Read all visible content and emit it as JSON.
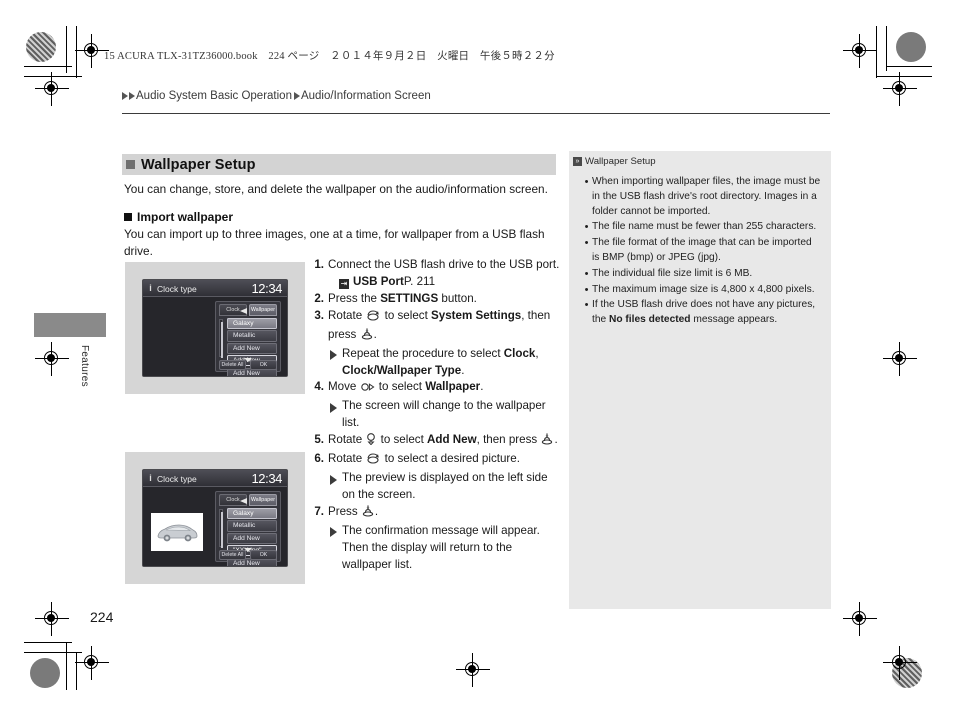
{
  "book_header": "15 ACURA TLX-31TZ36000.book　224 ページ　２０１４年９月２日　火曜日　午後５時２２分",
  "breadcrumb": {
    "crumb1": "Audio System Basic Operation",
    "crumb2": "Audio/Information Screen"
  },
  "side_tab": {
    "label": "Features"
  },
  "page_number": "224",
  "section": {
    "title": "Wallpaper Setup",
    "description": "You can change, store, and delete the wallpaper on the audio/information screen."
  },
  "subsection": {
    "title": "Import wallpaper",
    "description": "You can import up to three images, one at a time, for wallpaper from a USB flash drive."
  },
  "steps": [
    {
      "num": "1.",
      "text_parts": [
        {
          "t": "Connect the USB flash drive to the USB port."
        }
      ],
      "reference": {
        "icon": "arrow-into-box-icon",
        "label": "USB Port",
        "page": "P. 211"
      }
    },
    {
      "num": "2.",
      "text_parts": [
        {
          "t": "Press the "
        },
        {
          "t": "SETTINGS",
          "bold": true
        },
        {
          "t": " button."
        }
      ]
    },
    {
      "num": "3.",
      "text_parts": [
        {
          "t": "Rotate "
        },
        {
          "icon": "rotate-knob-icon"
        },
        {
          "t": " to select "
        },
        {
          "t": "System Settings",
          "bold": true
        },
        {
          "t": ", then press "
        },
        {
          "icon": "press-knob-icon"
        },
        {
          "t": "."
        }
      ],
      "subs": [
        {
          "parts": [
            {
              "t": "Repeat the procedure to select "
            },
            {
              "t": "Clock",
              "bold": true
            },
            {
              "t": ", "
            },
            {
              "t": "Clock/Wallpaper Type",
              "bold": true
            },
            {
              "t": "."
            }
          ]
        }
      ]
    },
    {
      "num": "4.",
      "text_parts": [
        {
          "t": "Move "
        },
        {
          "icon": "move-right-icon"
        },
        {
          "t": " to select "
        },
        {
          "t": "Wallpaper",
          "bold": true
        },
        {
          "t": "."
        }
      ],
      "subs": [
        {
          "parts": [
            {
              "t": "The screen will change to the wallpaper list."
            }
          ]
        }
      ]
    },
    {
      "num": "5.",
      "text_parts": [
        {
          "t": "Rotate "
        },
        {
          "icon": "rotate-down-icon"
        },
        {
          "t": " to select "
        },
        {
          "t": "Add New",
          "bold": true
        },
        {
          "t": ", then press "
        },
        {
          "icon": "press-knob-icon"
        },
        {
          "t": "."
        }
      ]
    },
    {
      "num": "6.",
      "text_parts": [
        {
          "t": "Rotate "
        },
        {
          "icon": "rotate-knob-icon"
        },
        {
          "t": " to select a desired picture."
        }
      ],
      "subs": [
        {
          "parts": [
            {
              "t": "The preview is displayed on the left side on the screen."
            }
          ]
        }
      ]
    },
    {
      "num": "7.",
      "text_parts": [
        {
          "t": "Press "
        },
        {
          "icon": "press-knob-icon"
        },
        {
          "t": "."
        }
      ],
      "subs": [
        {
          "parts": [
            {
              "t": "The confirmation message will appear. Then the display will return to the wallpaper list."
            }
          ]
        }
      ]
    }
  ],
  "note": {
    "heading": "Wallpaper Setup",
    "items": [
      {
        "parts": [
          {
            "t": "When importing wallpaper files, the image must be in the USB flash drive's root directory. Images in a folder cannot be imported."
          }
        ]
      },
      {
        "parts": [
          {
            "t": "The file name must be fewer than 255 characters."
          }
        ]
      },
      {
        "parts": [
          {
            "t": "The file format of the image that can be imported is BMP (bmp) or JPEG (jpg)."
          }
        ]
      },
      {
        "parts": [
          {
            "t": "The individual file size limit is 6 MB."
          }
        ]
      },
      {
        "parts": [
          {
            "t": "The maximum image size is 4,800 x 4,800 pixels."
          }
        ]
      },
      {
        "parts": [
          {
            "t": "If the USB flash drive does not have any pictures, the "
          },
          {
            "t": "No files detected",
            "bold": true
          },
          {
            "t": " message appears."
          }
        ]
      }
    ]
  },
  "figures": [
    {
      "name": "wallpaper-list-screen",
      "title": "Clock type",
      "clock": "12:34",
      "tabs": [
        {
          "label": "Clock",
          "active": false
        },
        {
          "label": "Wallpaper",
          "active": true
        }
      ],
      "rows": [
        {
          "label": "Galaxy",
          "state": "highlight"
        },
        {
          "label": "Metallic",
          "state": "normal"
        },
        {
          "label": "Add New",
          "state": "normal"
        },
        {
          "label": "Add New",
          "state": "selected"
        },
        {
          "label": "Add New",
          "state": "normal"
        }
      ],
      "buttons": [
        "Delete All",
        "OK"
      ],
      "has_preview": false
    },
    {
      "name": "wallpaper-preview-screen",
      "title": "Clock type",
      "clock": "12:34",
      "tabs": [
        {
          "label": "Clock",
          "active": false
        },
        {
          "label": "Wallpaper",
          "active": true
        }
      ],
      "rows": [
        {
          "label": "Galaxy",
          "state": "highlight"
        },
        {
          "label": "Metallic",
          "state": "normal"
        },
        {
          "label": "Add New",
          "state": "normal"
        },
        {
          "label": "\"XXX.jpg\"",
          "state": "selected"
        },
        {
          "label": "Add New",
          "state": "normal"
        }
      ],
      "buttons": [
        "Delete All",
        "OK"
      ],
      "has_preview": true
    }
  ]
}
